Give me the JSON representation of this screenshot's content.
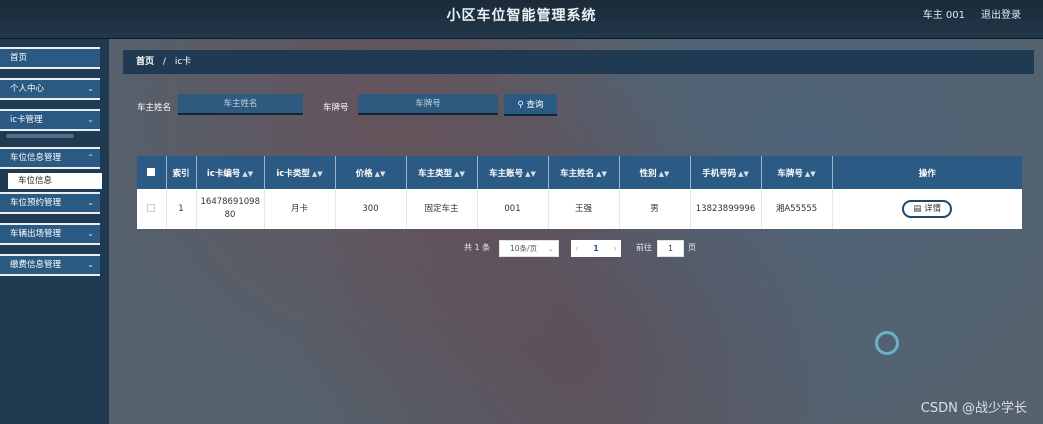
{
  "header": {
    "title": "小区车位智能管理系统",
    "user": "车主 001",
    "logout": "退出登录"
  },
  "sidebar": {
    "items": [
      {
        "label": "首页",
        "has_children": false
      },
      {
        "label": "个人中心",
        "has_children": true
      },
      {
        "label": "ic卡管理",
        "has_children": true
      },
      {
        "label": "车位信息管理",
        "has_children": true
      },
      {
        "label": "车位预约管理",
        "has_children": true
      },
      {
        "label": "车辆出场管理",
        "has_children": true
      },
      {
        "label": "缴费信息管理",
        "has_children": true
      }
    ],
    "open_submenu": {
      "parent": "车位信息管理",
      "label": "车位信息"
    }
  },
  "breadcrumb": {
    "home": "首页",
    "separator": "/",
    "current": "ic卡"
  },
  "search": {
    "owner_name_label": "车主姓名",
    "owner_name_placeholder": "车主姓名",
    "plate_label": "车牌号",
    "plate_placeholder": "车牌号",
    "button": "查询"
  },
  "table": {
    "columns": [
      "索引",
      "ic卡编号",
      "ic卡类型",
      "价格",
      "车主类型",
      "车主账号",
      "车主姓名",
      "性别",
      "手机号码",
      "车牌号",
      "操作"
    ],
    "rows": [
      {
        "index": "1",
        "card_no_line1": "16478691098",
        "card_no_line2": "80",
        "card_type": "月卡",
        "price": "300",
        "owner_type": "固定车主",
        "owner_account": "001",
        "owner_name": "王强",
        "gender": "男",
        "phone": "13823899996",
        "plate": "湘A55555",
        "action": "详情"
      }
    ]
  },
  "pagination": {
    "total": "共 1 条",
    "page_size": "10条/页",
    "current_page": "1",
    "goto_label": "前往",
    "goto_value": "1",
    "page_unit": "页"
  },
  "watermark": "CSDN @战少学长",
  "colors": {
    "accent": "#2b5b85",
    "topbar": "#1a2a38",
    "sidebar": "#203a52"
  }
}
